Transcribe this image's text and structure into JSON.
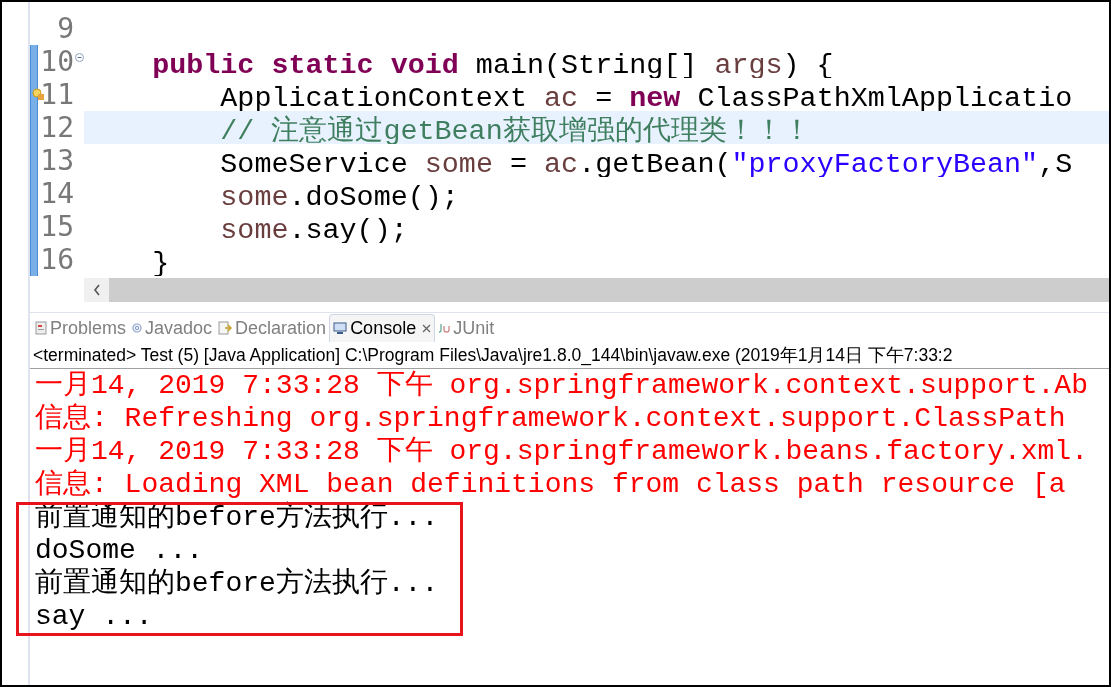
{
  "editor": {
    "lines": [
      {
        "number": "9",
        "changed": false,
        "highlighted": false
      },
      {
        "number": "10",
        "changed": true,
        "highlighted": false,
        "kind": "fold",
        "tokens": [
          {
            "text": "public static void",
            "kind": "keyword"
          },
          {
            "text": " main(String[] ",
            "kind": "plain"
          },
          {
            "text": "args",
            "kind": "variable"
          },
          {
            "text": ") {",
            "kind": "plain"
          }
        ],
        "children": [
          {
            "number": "11",
            "changed": true,
            "highlighted": false,
            "kind": "warning",
            "tokens": [
              {
                "text": "ApplicationContext ",
                "kind": "plain"
              },
              {
                "text": "ac",
                "kind": "variable"
              },
              {
                "text": " = ",
                "kind": "plain"
              },
              {
                "text": "new",
                "kind": "keyword"
              },
              {
                "text": " ClassPathXmlApplicatio",
                "kind": "plain"
              }
            ]
          },
          {
            "number": "12",
            "changed": true,
            "highlighted": true,
            "tokens": [
              {
                "text": "// 注意通过getBean获取增强的代理类！！！",
                "kind": "comment"
              }
            ]
          },
          {
            "number": "13",
            "changed": true,
            "highlighted": false,
            "tokens": [
              {
                "text": "SomeService ",
                "kind": "plain"
              },
              {
                "text": "some",
                "kind": "variable"
              },
              {
                "text": " = ",
                "kind": "plain"
              },
              {
                "text": "ac",
                "kind": "variable"
              },
              {
                "text": ".getBean(",
                "kind": "plain"
              },
              {
                "text": "\"proxyFactoryBean\"",
                "kind": "string"
              },
              {
                "text": ",S",
                "kind": "plain"
              }
            ]
          },
          {
            "number": "14",
            "changed": true,
            "highlighted": false,
            "tokens": [
              {
                "text": "some",
                "kind": "variable"
              },
              {
                "text": ".doSome();",
                "kind": "plain"
              }
            ]
          },
          {
            "number": "15",
            "changed": true,
            "highlighted": false,
            "tokens": [
              {
                "text": "some",
                "kind": "variable"
              },
              {
                "text": ".say();",
                "kind": "plain"
              }
            ]
          }
        ]
      },
      {
        "number": "16",
        "changed": true,
        "highlighted": false,
        "tokens": [
          {
            "text": "}",
            "kind": "plain"
          }
        ]
      }
    ]
  },
  "tabs": [
    {
      "label": "Problems",
      "selected": false
    },
    {
      "label": "Javadoc",
      "selected": false
    },
    {
      "label": "Declaration",
      "selected": false
    },
    {
      "label": "Console",
      "selected": true
    },
    {
      "label": "JUnit",
      "selected": false
    }
  ],
  "console": {
    "header": "<terminated> Test (5) [Java Application] C:\\Program Files\\Java\\jre1.8.0_144\\bin\\javaw.exe (2019年1月14日 下午7:33:2",
    "lines": [
      {
        "text": "一月14, 2019 7:33:28 下午 org.springframework.context.support.Ab",
        "kind": "stderr"
      },
      {
        "text": "信息: Refreshing org.springframework.context.support.ClassPath",
        "kind": "stderr"
      },
      {
        "text": "一月14, 2019 7:33:28 下午 org.springframework.beans.factory.xml.",
        "kind": "stderr"
      },
      {
        "text": "信息: Loading XML bean definitions from class path resource [a",
        "kind": "stderr"
      },
      {
        "text": "前置通知的before方法执行...",
        "kind": "stdout"
      },
      {
        "text": "doSome ...",
        "kind": "stdout"
      },
      {
        "text": "前置通知的before方法执行...",
        "kind": "stdout"
      },
      {
        "text": "say ...",
        "kind": "stdout"
      }
    ]
  }
}
